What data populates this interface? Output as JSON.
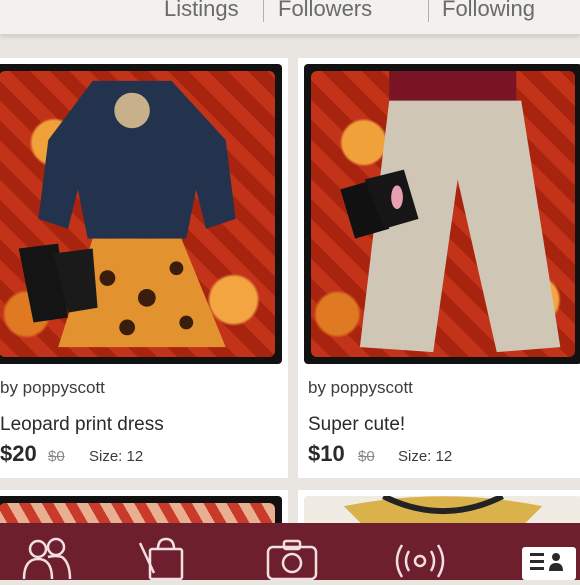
{
  "stats": {
    "listings_label": "Listings",
    "followers_label": "Followers",
    "following_label": "Following"
  },
  "listings": [
    {
      "seller": "by poppyscott",
      "title": "Leopard print dress",
      "price": "$20",
      "original_price": "$0",
      "size": "Size: 12"
    },
    {
      "seller": "by poppyscott",
      "title": "Super cute!",
      "price": "$10",
      "original_price": "$0",
      "size": "Size: 12"
    }
  ],
  "nav": {
    "items": [
      "members-icon",
      "shopping-bag-icon",
      "camera-icon",
      "broadcast-icon",
      "profile-list-icon"
    ],
    "background_color": "#6e1f2e"
  }
}
